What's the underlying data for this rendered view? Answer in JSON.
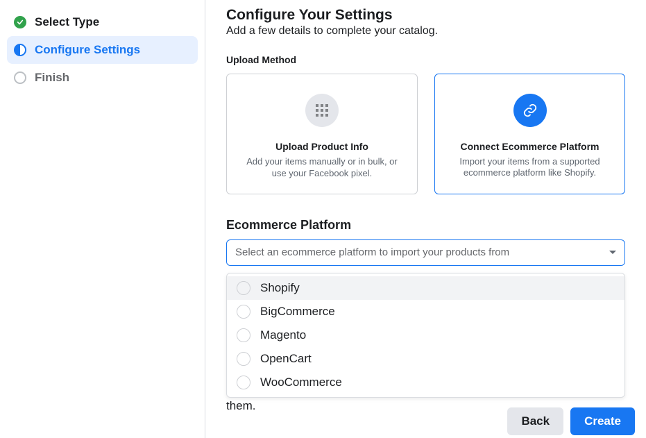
{
  "sidebar": {
    "steps": [
      {
        "label": "Select Type",
        "state": "complete"
      },
      {
        "label": "Configure Settings",
        "state": "active"
      },
      {
        "label": "Finish",
        "state": "pending"
      }
    ]
  },
  "header": {
    "title": "Configure Your Settings",
    "subtitle": "Add a few details to complete your catalog."
  },
  "upload_method": {
    "section_label": "Upload Method",
    "options": [
      {
        "id": "upload-product-info",
        "title": "Upload Product Info",
        "description": "Add your items manually or in bulk, or use your Facebook pixel.",
        "icon": "grid-icon",
        "selected": false
      },
      {
        "id": "connect-ecommerce",
        "title": "Connect Ecommerce Platform",
        "description": "Import your items from a supported ecommerce platform like Shopify.",
        "icon": "link-icon",
        "selected": true
      }
    ]
  },
  "platform": {
    "label": "Ecommerce Platform",
    "placeholder": "Select an ecommerce platform to import your products from",
    "options": [
      {
        "label": "Shopify",
        "highlighted": true
      },
      {
        "label": "BigCommerce",
        "highlighted": false
      },
      {
        "label": "Magento",
        "highlighted": false
      },
      {
        "label": "OpenCart",
        "highlighted": false
      },
      {
        "label": "WooCommerce",
        "highlighted": false
      }
    ]
  },
  "truncated_text_visible": "them.",
  "footer": {
    "back_label": "Back",
    "create_label": "Create"
  }
}
